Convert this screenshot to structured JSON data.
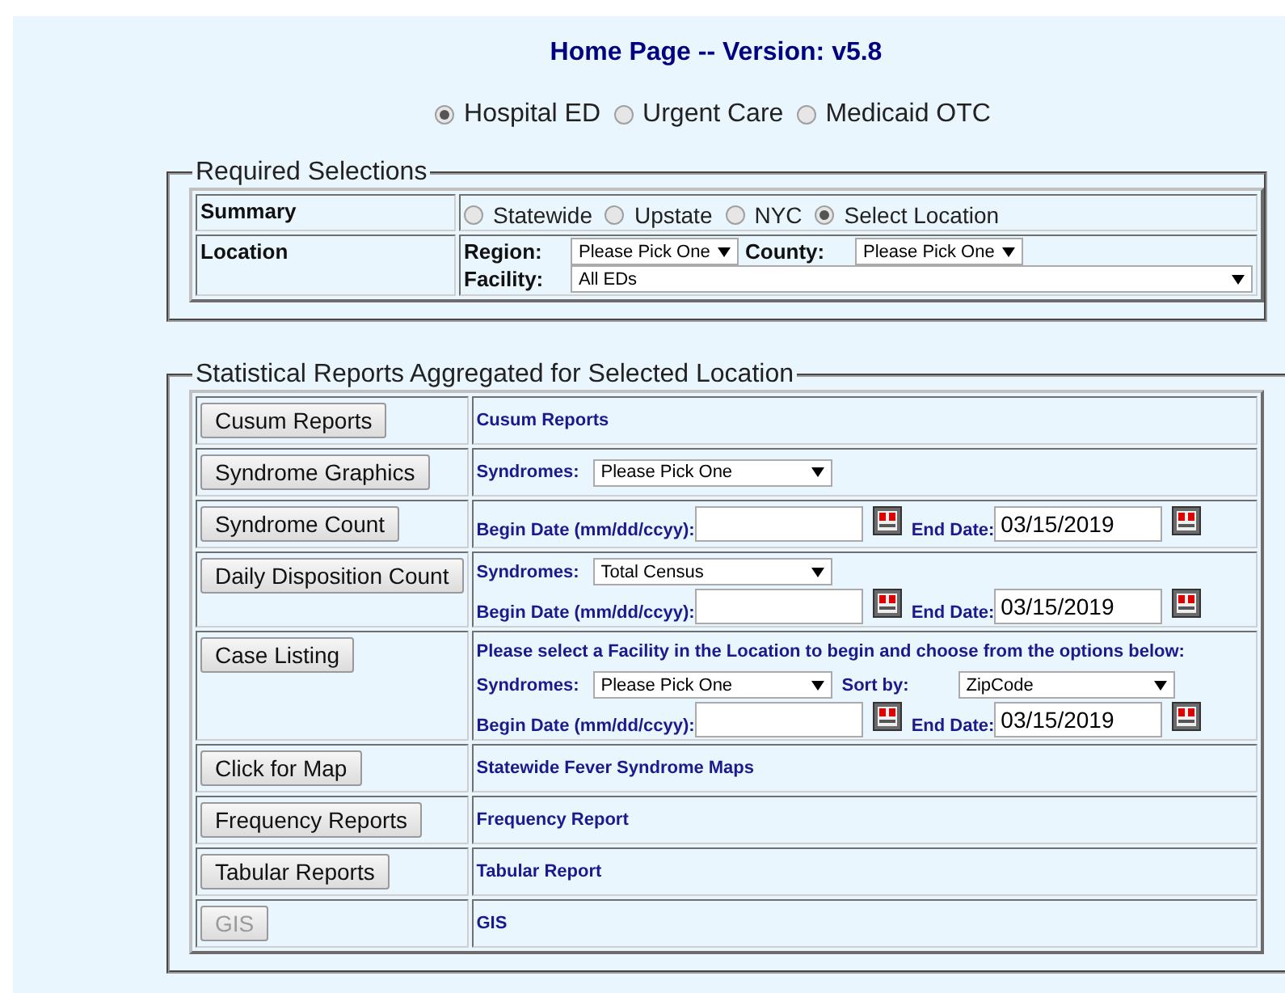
{
  "title": "Home Page -- Version: v5.8",
  "sources": [
    {
      "label": "Hospital ED",
      "selected": true
    },
    {
      "label": "Urgent Care",
      "selected": false
    },
    {
      "label": "Medicaid OTC",
      "selected": false
    }
  ],
  "required": {
    "legend": "Required Selections",
    "summary": {
      "label": "Summary",
      "options": [
        {
          "label": "Statewide",
          "selected": false
        },
        {
          "label": "Upstate",
          "selected": false
        },
        {
          "label": "NYC",
          "selected": false
        },
        {
          "label": "Select Location",
          "selected": true
        }
      ]
    },
    "location": {
      "label": "Location",
      "region_label": "Region:",
      "region_value": "Please Pick One",
      "county_label": "County:",
      "county_value": "Please Pick One",
      "facility_label": "Facility:",
      "facility_value": "All EDs"
    }
  },
  "reports": {
    "legend": "Statistical Reports Aggregated for Selected Location",
    "rows": [
      {
        "button": "Cusum Reports",
        "disabled": false,
        "lines": [
          [
            {
              "kind": "text",
              "text": "Cusum Reports"
            }
          ]
        ]
      },
      {
        "button": "Syndrome Graphics",
        "disabled": false,
        "lines": [
          [
            {
              "kind": "select",
              "label": "Syndromes:",
              "value": "Please Pick One"
            }
          ]
        ]
      },
      {
        "button": "Syndrome Count",
        "disabled": false,
        "lines": [
          [
            {
              "kind": "dates",
              "begin_label": "Begin Date (mm/dd/ccyy):",
              "end_label": "End Date:",
              "end_value": "03/15/2019"
            }
          ]
        ]
      },
      {
        "button": "Daily Disposition Count",
        "disabled": false,
        "lines": [
          [
            {
              "kind": "select",
              "label": "Syndromes:",
              "value": "Total Census"
            }
          ],
          [
            {
              "kind": "dates",
              "begin_label": "Begin Date (mm/dd/ccyy):",
              "end_label": "End Date:",
              "end_value": "03/15/2019"
            }
          ]
        ]
      },
      {
        "button": "Case Listing",
        "disabled": false,
        "lines": [
          [
            {
              "kind": "text",
              "text": "Please select a Facility in the Location to begin and choose from the options below:"
            }
          ],
          [
            {
              "kind": "select",
              "label": "Syndromes:",
              "value": "Please Pick One"
            },
            {
              "kind": "select",
              "label": "Sort by:",
              "value": "ZipCode"
            }
          ],
          [
            {
              "kind": "dates",
              "begin_label": "Begin Date (mm/dd/ccyy):",
              "end_label": "End Date:",
              "end_value": "03/15/2019"
            }
          ]
        ]
      },
      {
        "button": "Click for Map",
        "disabled": false,
        "lines": [
          [
            {
              "kind": "text",
              "text": "Statewide Fever Syndrome Maps"
            }
          ]
        ]
      },
      {
        "button": "Frequency Reports",
        "disabled": false,
        "lines": [
          [
            {
              "kind": "text",
              "text": "Frequency Report"
            }
          ]
        ]
      },
      {
        "button": "Tabular Reports",
        "disabled": false,
        "lines": [
          [
            {
              "kind": "text",
              "text": "Tabular Report"
            }
          ]
        ]
      },
      {
        "button": "GIS",
        "disabled": true,
        "lines": [
          [
            {
              "kind": "text",
              "text": "GIS"
            }
          ]
        ]
      }
    ]
  }
}
